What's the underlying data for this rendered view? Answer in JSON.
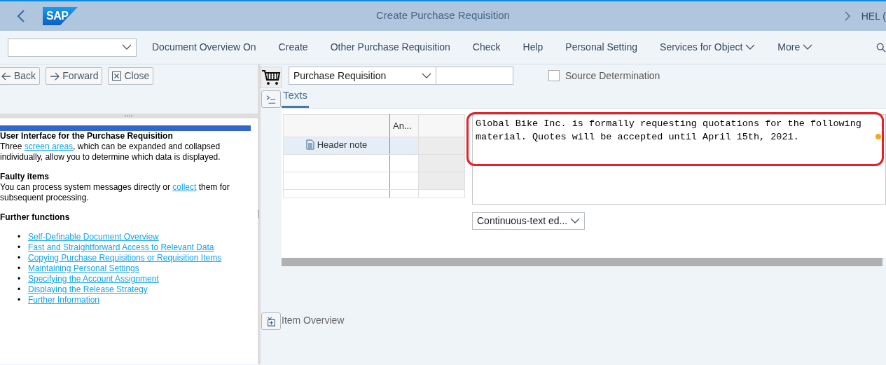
{
  "header": {
    "logo": "SAP",
    "title": "Create Purchase Requisition",
    "user": "HEL ("
  },
  "toolbar": {
    "items": [
      {
        "label": "Document Overview On",
        "has_menu": false
      },
      {
        "label": "Create",
        "has_menu": false
      },
      {
        "label": "Other Purchase Requisition",
        "has_menu": false
      },
      {
        "label": "Check",
        "has_menu": false
      },
      {
        "label": "Help",
        "has_menu": false
      },
      {
        "label": "Personal Setting",
        "has_menu": false
      },
      {
        "label": "Services for Object",
        "has_menu": true
      },
      {
        "label": "More",
        "has_menu": true
      }
    ]
  },
  "nav_buttons": [
    {
      "label": "Back",
      "kind": "back"
    },
    {
      "label": "Forward",
      "kind": "forward"
    },
    {
      "label": "Close",
      "kind": "close"
    }
  ],
  "help": {
    "sections": [
      {
        "heading": "User Interface for the Purchase Requisition",
        "before": "Three ",
        "link": "screen areas",
        "after": ", which can be expanded and collapsed individually, allow you to determine which data is displayed."
      },
      {
        "heading": "Faulty items",
        "before": "You can process system messages directly or ",
        "link": "collect",
        "after": " them for subsequent processing."
      },
      {
        "heading": "Further functions"
      }
    ],
    "links": [
      {
        "marker": "•",
        "label": "Self-Definable Document Overview"
      },
      {
        "marker": "•",
        "label": "Fast and Straightforward Access to Relevant Data"
      },
      {
        "marker": "•",
        "label": "Copying Purchase Requisitions or Requisition Items"
      },
      {
        "marker": "•",
        "label": "Maintaining Personal Settings"
      },
      {
        "marker": "•",
        "label": "Specifying the Account Assignment"
      },
      {
        "marker": "•",
        "label": "Displaying the Release Strategy"
      },
      {
        "marker": "•",
        "label": "Further Information"
      }
    ]
  },
  "document": {
    "type": "Purchase Requisition",
    "source_determination": {
      "label": "Source Determination",
      "checked": false
    }
  },
  "tabs": [
    {
      "label": "Texts",
      "selected": true
    }
  ],
  "text_table": {
    "columns": [
      "An..."
    ],
    "rows": [
      {
        "label": "Header note",
        "selected": true
      }
    ]
  },
  "editor": {
    "value": "Global Bike Inc. is formally requesting quotations for the following material. Quotes will be accepted until April 15th, 2021.",
    "mode": "Continuous-text ed..."
  },
  "item_overview": {
    "label": "Item Overview"
  }
}
